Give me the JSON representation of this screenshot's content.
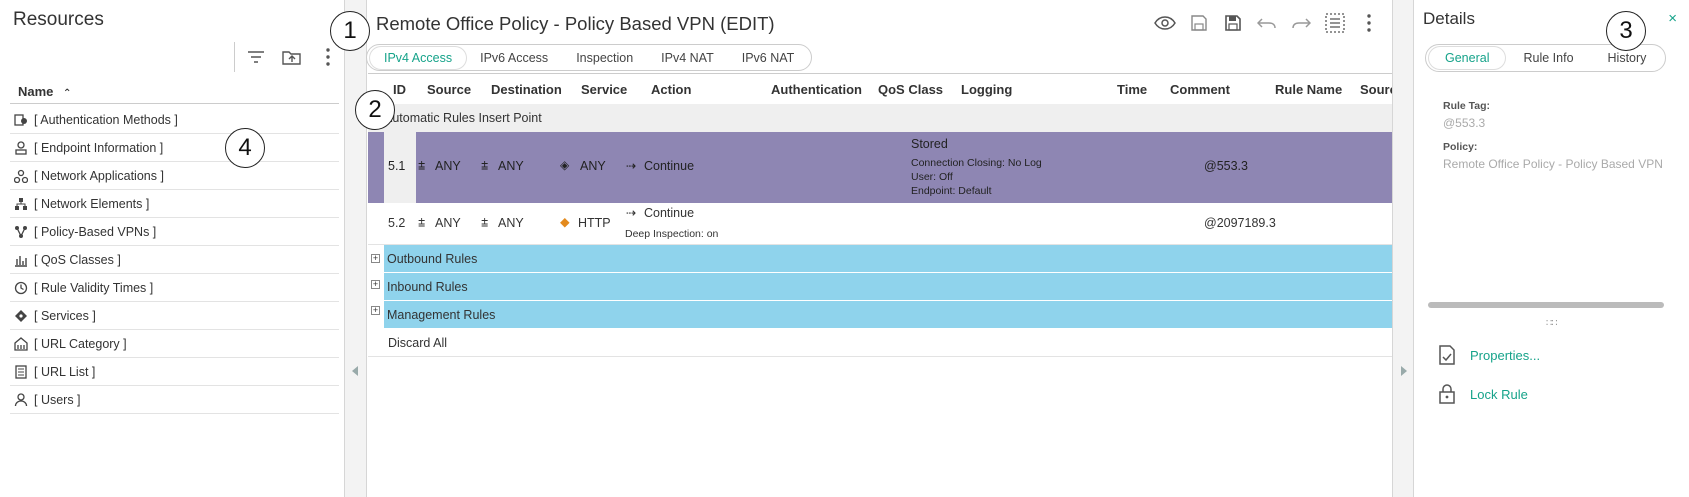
{
  "resources": {
    "title": "Resources",
    "column_header": "Name",
    "items": [
      {
        "label": "[ Authentication Methods ]",
        "icon": "auth-methods-icon"
      },
      {
        "label": "[ Endpoint Information ]",
        "icon": "endpoint-icon"
      },
      {
        "label": "[ Network Applications ]",
        "icon": "network-apps-icon"
      },
      {
        "label": "[ Network Elements ]",
        "icon": "network-elements-icon"
      },
      {
        "label": "[ Policy-Based VPNs ]",
        "icon": "vpn-icon"
      },
      {
        "label": "[ QoS Classes ]",
        "icon": "qos-icon"
      },
      {
        "label": "[ Rule Validity Times ]",
        "icon": "clock-icon"
      },
      {
        "label": "[ Services ]",
        "icon": "service-icon"
      },
      {
        "label": "[ URL Category ]",
        "icon": "url-category-icon"
      },
      {
        "label": "[ URL List ]",
        "icon": "url-list-icon"
      },
      {
        "label": "[ Users ]",
        "icon": "user-icon"
      }
    ]
  },
  "callouts": {
    "c1": "1",
    "c2": "2",
    "c3": "3",
    "c4": "4"
  },
  "policy": {
    "title": "Remote Office Policy - Policy Based VPN (EDIT)",
    "tabs": [
      "IPv4 Access",
      "IPv6 Access",
      "Inspection",
      "IPv4 NAT",
      "IPv6 NAT"
    ],
    "active_tab": "IPv4 Access",
    "columns": [
      "ID",
      "Source",
      "Destination",
      "Service",
      "Action",
      "Authentication",
      "QoS Class",
      "Logging",
      "Time",
      "Comment",
      "Rule Name",
      "Sourc"
    ],
    "insert_point": "Automatic Rules Insert Point",
    "rules": [
      {
        "id": "5.1",
        "source": "ANY",
        "destination": "ANY",
        "service": "ANY",
        "action": "Continue",
        "logging_title": "Stored",
        "logging_details": [
          "Connection Closing: No Log",
          "User: Off",
          "Endpoint: Default"
        ],
        "rule_name": "@553.3"
      },
      {
        "id": "5.2",
        "source": "ANY",
        "destination": "ANY",
        "service": "HTTP",
        "action": "Continue",
        "action_detail": "Deep Inspection: on",
        "rule_name": "@2097189.3"
      }
    ],
    "sections": [
      "Outbound Rules",
      "Inbound Rules",
      "Management Rules"
    ],
    "discard": "Discard All"
  },
  "details": {
    "title": "Details",
    "close": "×",
    "tabs": [
      "General",
      "Rule Info",
      "History"
    ],
    "active_tab": "General",
    "rule_tag_label": "Rule Tag:",
    "rule_tag_value": "@553.3",
    "policy_label": "Policy:",
    "policy_value": "Remote Office Policy - Policy Based VPN",
    "actions": [
      "Properties...",
      "Lock Rule"
    ]
  },
  "colors": {
    "accent": "#16a38a",
    "selected_row": "#8e86b3",
    "section_row": "#8fd3ec"
  }
}
